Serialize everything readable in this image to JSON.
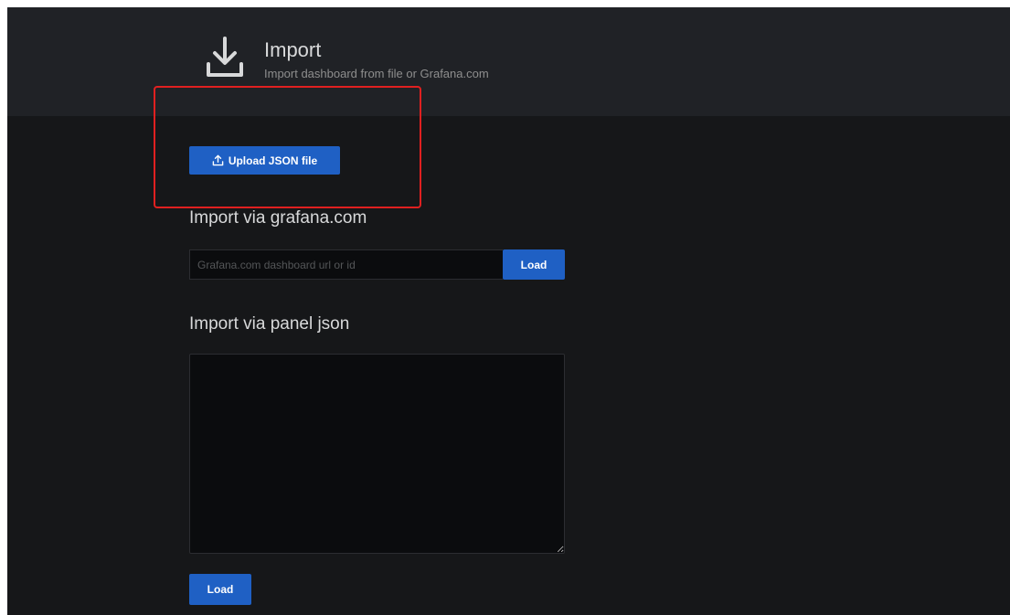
{
  "header": {
    "title": "Import",
    "subtitle": "Import dashboard from file or Grafana.com",
    "icon": "import-download-icon"
  },
  "upload": {
    "label": "Upload JSON file",
    "icon": "upload-icon"
  },
  "grafana_import": {
    "title": "Import via grafana.com",
    "placeholder": "Grafana.com dashboard url or id",
    "value": "",
    "button_label": "Load"
  },
  "panel_import": {
    "title": "Import via panel json",
    "value": "",
    "button_label": "Load"
  },
  "colors": {
    "background": "#161719",
    "header_background": "#202226",
    "primary_button": "#1f60c4",
    "highlight": "#e02020"
  }
}
